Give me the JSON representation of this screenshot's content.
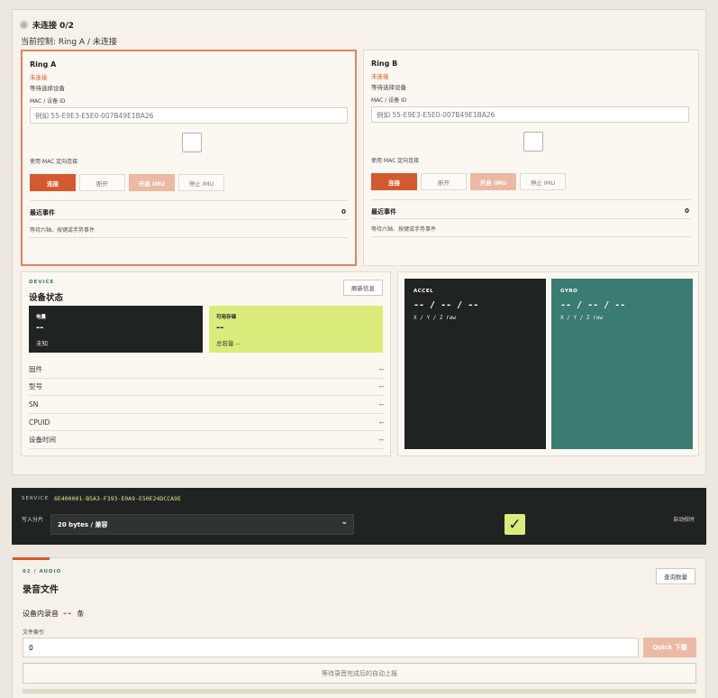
{
  "header": {
    "status": "未连接 0/2",
    "control": "当前控制: Ring A / 未连接"
  },
  "rings": [
    {
      "title": "Ring A",
      "conn_status": "未连接",
      "wait_text": "等待选择设备",
      "mac_label": "MAC / 设备 ID",
      "mac_placeholder": "例如 55-E9E3-E5E0-007B49E1BA26",
      "mac_conn_label": "使用 MAC 定向连接",
      "btn_connect": "连接",
      "btn_disconnect": "断开",
      "btn_imu_on": "开启 IMU",
      "btn_imu_off": "停止 IMU",
      "events_label": "最近事件",
      "events_count": "0",
      "events_text": "等待六轴、按键或手势事件"
    },
    {
      "title": "Ring B",
      "conn_status": "未连接",
      "wait_text": "等待选择设备",
      "mac_label": "MAC / 设备 ID",
      "mac_placeholder": "例如 55-E9E3-E5E0-007B49E1BA26",
      "mac_conn_label": "使用 MAC 定向连接",
      "btn_connect": "连接",
      "btn_disconnect": "断开",
      "btn_imu_on": "开启 IMU",
      "btn_imu_off": "停止 IMU",
      "events_label": "最近事件",
      "events_count": "0",
      "events_text": "等待六轴、按键或手势事件"
    }
  ],
  "device": {
    "eyebrow": "DEVICE",
    "heading": "设备状态",
    "refresh": "刷新信息",
    "battery": {
      "label": "电量",
      "value": "--",
      "sub": "未知"
    },
    "storage": {
      "label": "可用存储",
      "value": "--",
      "sub": "总容量 --"
    },
    "rows": [
      {
        "label": "固件",
        "value": "--"
      },
      {
        "label": "型号",
        "value": "--"
      },
      {
        "label": "SN",
        "value": "--"
      },
      {
        "label": "CPUID",
        "value": "--"
      },
      {
        "label": "设备时间",
        "value": "--"
      }
    ]
  },
  "imu": {
    "accel": {
      "label": "ACCEL",
      "value": "-- / -- / --",
      "sub": "X / Y / Z raw"
    },
    "gyro": {
      "label": "GYRO",
      "value": "-- / -- / --",
      "sub": "X / Y / Z raw"
    }
  },
  "service": {
    "label": "SERVICE",
    "uuid": "6E400001-B5A3-F393-E0A9-E50E24DCCA9E",
    "write_label": "写入分片",
    "write_value": "20 bytes / 兼容",
    "auto_label": "自动校时",
    "auto_checked": true
  },
  "audio": {
    "eyebrow": "02 / AUDIO",
    "heading": "录音文件",
    "query": "查询数量",
    "count_label": "设备内录音",
    "count_value": "--",
    "count_unit": "条",
    "index_label": "文件索引",
    "index_value": "0",
    "download": "Quick 下载",
    "wait_text": "等待录音完成后的自动上报"
  },
  "colors": {
    "accent": "#d5592f",
    "lime": "#dcec7c",
    "teal": "#3a7b72",
    "dark": "#1f2322"
  }
}
